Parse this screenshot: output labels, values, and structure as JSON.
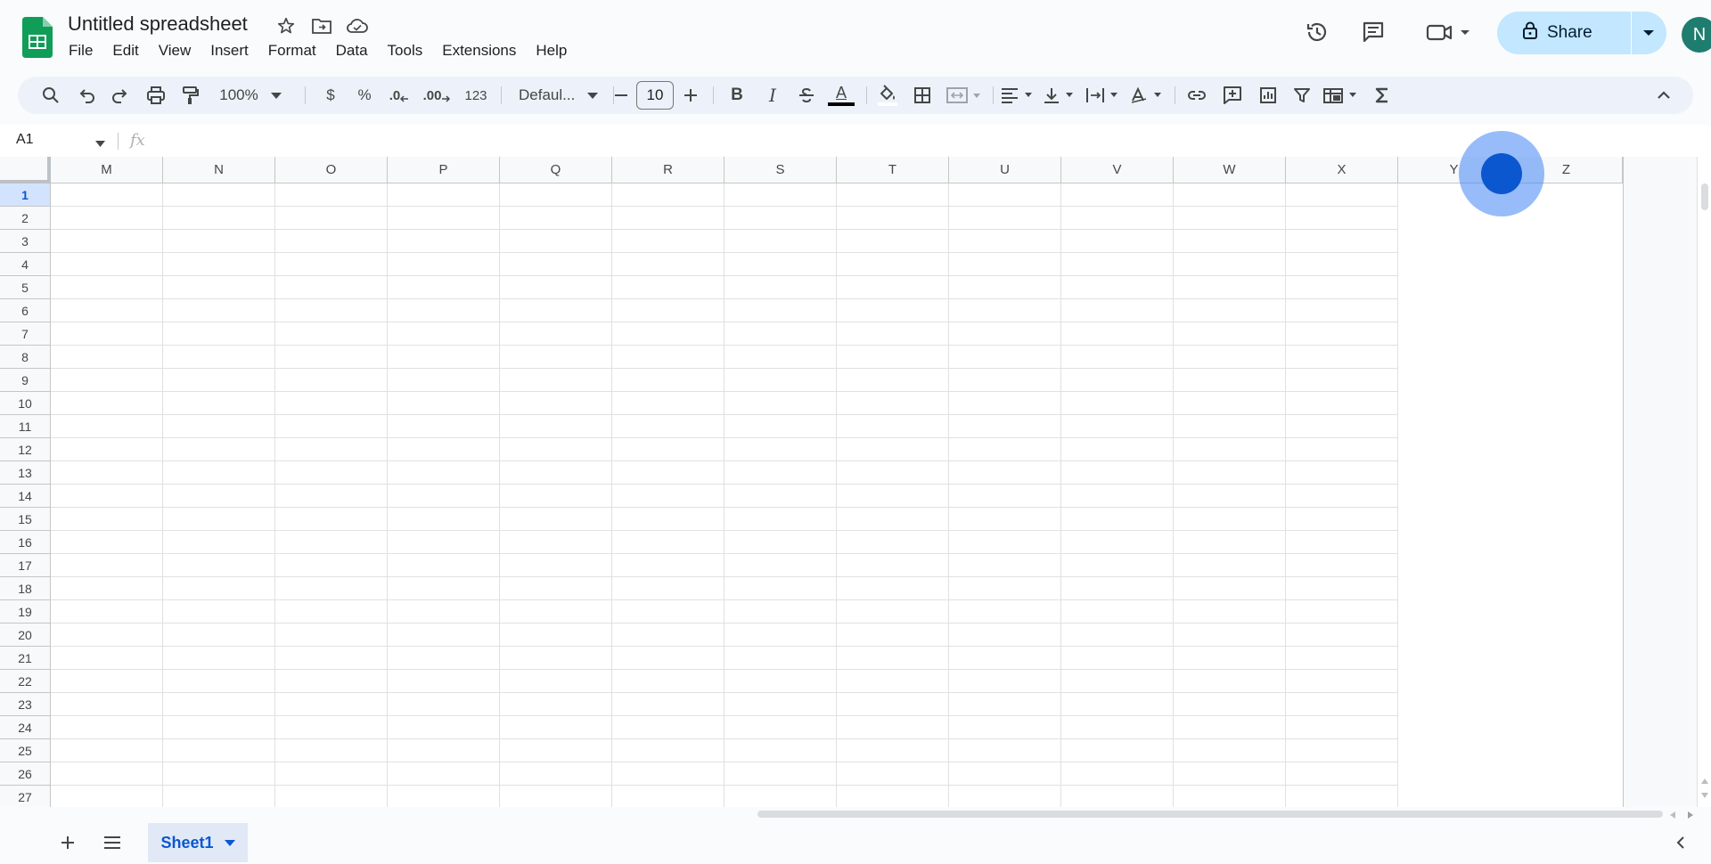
{
  "document": {
    "title": "Untitled spreadsheet"
  },
  "menu": [
    "File",
    "Edit",
    "View",
    "Insert",
    "Format",
    "Data",
    "Tools",
    "Extensions",
    "Help"
  ],
  "share": {
    "label": "Share"
  },
  "user": {
    "initial": "N",
    "avatar_color": "#1e7d6e"
  },
  "toolbar": {
    "zoom": "100%",
    "currency": "$",
    "percent": "%",
    "dec_decrease": ".0",
    "dec_increase": ".00",
    "more_formats": "123",
    "font": "Defaul...",
    "font_size": "10",
    "bold": "B",
    "italic": "I",
    "text_color_letter": "A"
  },
  "formula_bar": {
    "cell_ref": "A1",
    "fx": "fx",
    "content": ""
  },
  "grid": {
    "columns": [
      "M",
      "N",
      "O",
      "P",
      "Q",
      "R",
      "S",
      "T",
      "U",
      "V",
      "W",
      "X",
      "Y",
      "Z"
    ],
    "rows": [
      "1",
      "2",
      "3",
      "4",
      "5",
      "6",
      "7",
      "8",
      "9",
      "10",
      "11",
      "12",
      "13",
      "14",
      "15",
      "16",
      "17",
      "18",
      "19",
      "20",
      "21",
      "22",
      "23",
      "24",
      "25",
      "26",
      "27"
    ],
    "selected_row": "1"
  },
  "sheets": [
    {
      "name": "Sheet1",
      "active": true
    }
  ],
  "colors": {
    "accent": "#0b57d0",
    "share_bg": "#c2e7ff",
    "toolbar_bg": "#edf2fa",
    "sheets_green": "#0f9d58"
  }
}
